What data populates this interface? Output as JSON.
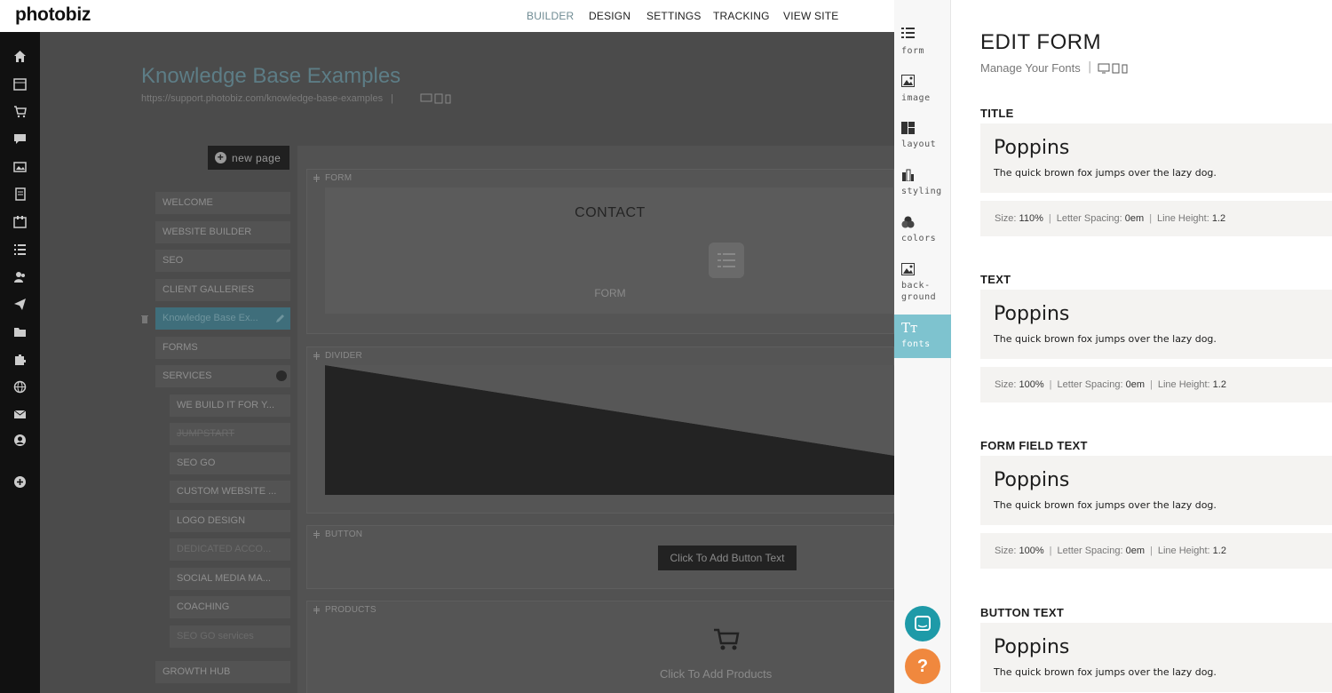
{
  "app": {
    "logo": "photobiz"
  },
  "topnav": {
    "builder": "BUILDER",
    "design": "DESIGN",
    "settings": "SETTINGS",
    "tracking": "TRACKING",
    "view_site": "VIEW SITE"
  },
  "page": {
    "title": "Knowledge Base Examples",
    "url": "https://support.photobiz.com/knowledge-base-examples",
    "url_sep": "|"
  },
  "sidebar": {
    "new_page": "new page",
    "items": [
      {
        "label": "WELCOME"
      },
      {
        "label": "WEBSITE BUILDER"
      },
      {
        "label": "SEO"
      },
      {
        "label": "CLIENT GALLERIES"
      },
      {
        "label": "Knowledge Base Ex..."
      },
      {
        "label": "FORMS"
      },
      {
        "label": "SERVICES"
      },
      {
        "label": "WE BUILD IT FOR Y..."
      },
      {
        "label": "JUMPSTART"
      },
      {
        "label": "SEO GO"
      },
      {
        "label": "CUSTOM WEBSITE ..."
      },
      {
        "label": "LOGO DESIGN"
      },
      {
        "label": "DEDICATED ACCO..."
      },
      {
        "label": "SOCIAL MEDIA MA..."
      },
      {
        "label": "COACHING"
      },
      {
        "label": "SEO GO services"
      },
      {
        "label": "GROWTH HUB"
      }
    ]
  },
  "blocks": {
    "form": {
      "label": "FORM",
      "heading": "CONTACT",
      "caption": "FORM"
    },
    "divider": {
      "label": "DIVIDER"
    },
    "button": {
      "label": "BUTTON",
      "text": "Click To Add Button Text"
    },
    "products": {
      "label": "PRODUCTS",
      "text": "Click To Add Products"
    }
  },
  "tabs": [
    {
      "label": "form",
      "icon": "form-icon"
    },
    {
      "label": "image",
      "icon": "image-icon"
    },
    {
      "label": "layout",
      "icon": "layout-icon"
    },
    {
      "label": "styling",
      "icon": "styling-icon"
    },
    {
      "label": "colors",
      "icon": "colors-icon"
    },
    {
      "label": "back-\nground",
      "icon": "background-icon"
    },
    {
      "label": "fonts",
      "icon": "fonts-icon",
      "active": true
    }
  ],
  "tab_fonts_glyph": "Tт",
  "help": {
    "glyph": "?"
  },
  "panel": {
    "title": "EDIT FORM",
    "subtitle": "Manage Your Fonts",
    "sep": "|",
    "sections": [
      {
        "heading": "TITLE",
        "font": "Poppins",
        "sample": "The quick brown fox jumps over the lazy dog.",
        "size_label": "Size:",
        "size": "110%",
        "ls_label": "Letter Spacing:",
        "ls": "0em",
        "lh_label": "Line Height:",
        "lh": "1.2"
      },
      {
        "heading": "TEXT",
        "font": "Poppins",
        "sample": "The quick brown fox jumps over the lazy dog.",
        "size_label": "Size:",
        "size": "100%",
        "ls_label": "Letter Spacing:",
        "ls": "0em",
        "lh_label": "Line Height:",
        "lh": "1.2"
      },
      {
        "heading": "FORM FIELD TEXT",
        "font": "Poppins",
        "sample": "The quick brown fox jumps over the lazy dog.",
        "size_label": "Size:",
        "size": "100%",
        "ls_label": "Letter Spacing:",
        "ls": "0em",
        "lh_label": "Line Height:",
        "lh": "1.2"
      },
      {
        "heading": "BUTTON TEXT",
        "font": "Poppins",
        "sample": "The quick brown fox jumps over the lazy dog."
      }
    ]
  },
  "colors": {
    "accent": "#7ec3cf",
    "chat": "#1e9aa8",
    "help": "#f0883e",
    "title_teal": "#5d7d86"
  }
}
